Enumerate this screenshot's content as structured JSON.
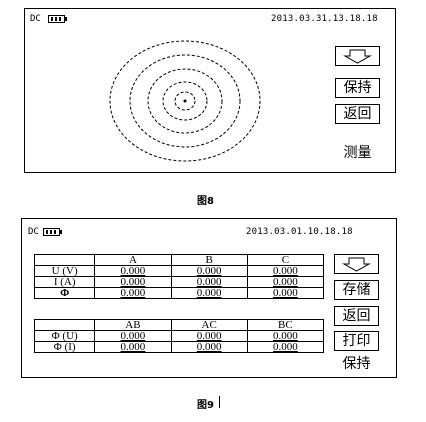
{
  "fig8": {
    "status": {
      "source": "DC",
      "datetime": "2013.03.31.13.18.18"
    },
    "buttons": {
      "hold": "保持",
      "back": "返回",
      "measure": "测量"
    },
    "caption": "图8"
  },
  "fig9": {
    "status": {
      "source": "DC",
      "datetime": "2013.03.01.10.18.18"
    },
    "table1": {
      "headers": [
        "",
        "A",
        "B",
        "C"
      ],
      "rows": [
        {
          "label": "U (V)",
          "values": [
            "0.000",
            "0.000",
            "0.000"
          ]
        },
        {
          "label": "I (A)",
          "values": [
            "0.000",
            "0.000",
            "0.000"
          ]
        },
        {
          "label": "Φ",
          "values": [
            "0.000",
            "0.000",
            "0.000"
          ]
        }
      ]
    },
    "table2": {
      "headers": [
        "",
        "AB",
        "AC",
        "BC"
      ],
      "rows": [
        {
          "label": "Φ (U)",
          "values": [
            "0.000",
            "0.000",
            "0.000"
          ]
        },
        {
          "label": "Φ (I)",
          "values": [
            "0.000",
            "0.000",
            "0.000"
          ]
        }
      ]
    },
    "buttons": {
      "save": "存储",
      "back": "返回",
      "print": "打印",
      "hold": "保持"
    },
    "caption": "图9"
  },
  "icons": {
    "down_arrow": "down-arrow-icon",
    "battery": "battery-icon"
  }
}
